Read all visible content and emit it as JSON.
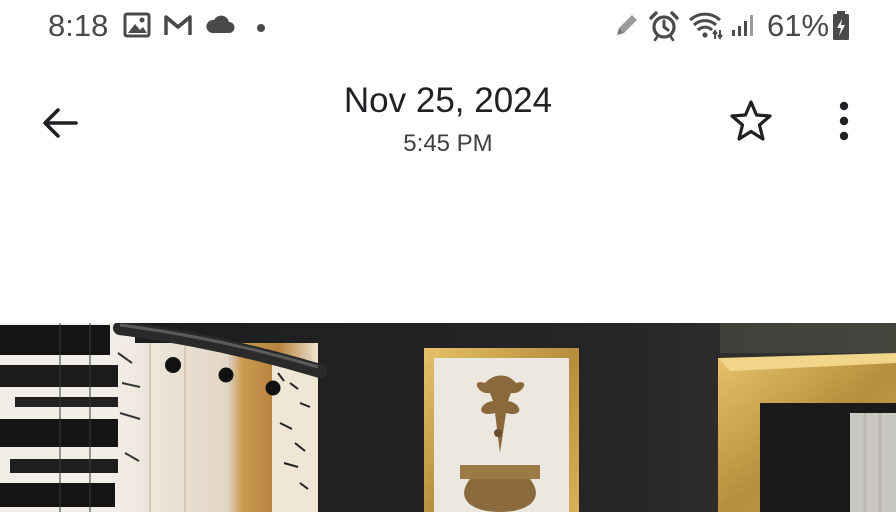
{
  "status_bar": {
    "time": "8:18",
    "left_icons": [
      "image-icon",
      "gmail-icon",
      "cloud-icon",
      "dot-icon"
    ],
    "right_icons": [
      "edit-pencil-icon",
      "alarm-icon",
      "wifi-icon",
      "signal-icon",
      "battery-icon"
    ],
    "battery_percent": "61%"
  },
  "app_bar": {
    "date": "Nov 25, 2024",
    "time": "5:45 PM",
    "icons": [
      "back-arrow-icon",
      "star-outline-icon",
      "more-vert-icon"
    ]
  },
  "photo": {
    "subject_colors": {
      "wall": "#1f1f1f",
      "frame_gold": "#c9a34a",
      "curtain_cream": "#efe7dc",
      "curtain_stripe": "#1a1a1a"
    }
  }
}
